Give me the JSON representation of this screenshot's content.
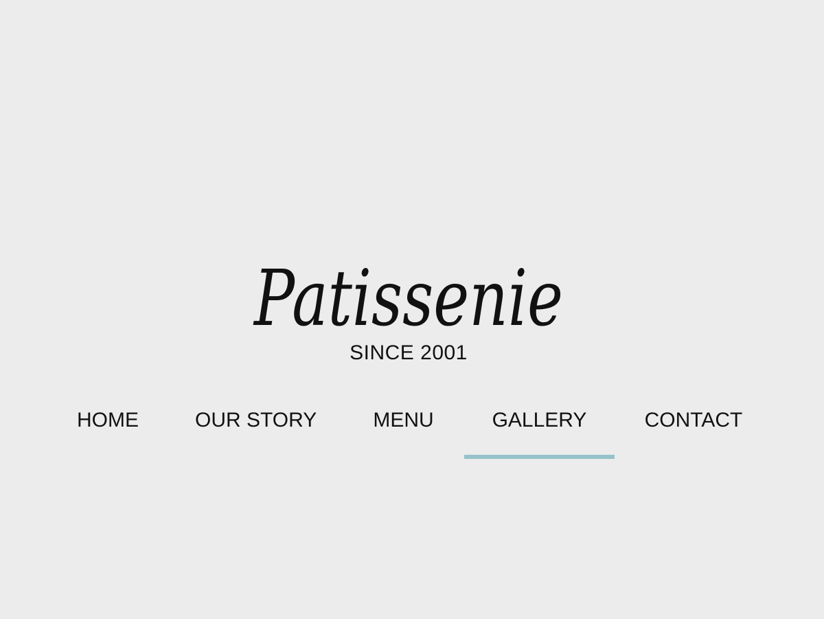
{
  "brand": {
    "logo_text": "Patissenie",
    "tagline": "SINCE 2001"
  },
  "nav": {
    "items": [
      {
        "label": "HOME"
      },
      {
        "label": "OUR STORY"
      },
      {
        "label": "MENU"
      },
      {
        "label": "GALLERY",
        "active": true
      },
      {
        "label": "CONTACT"
      }
    ],
    "active_index": 3
  },
  "colors": {
    "background": "#ececec",
    "text": "#111111",
    "accent": "#96c2ca"
  }
}
